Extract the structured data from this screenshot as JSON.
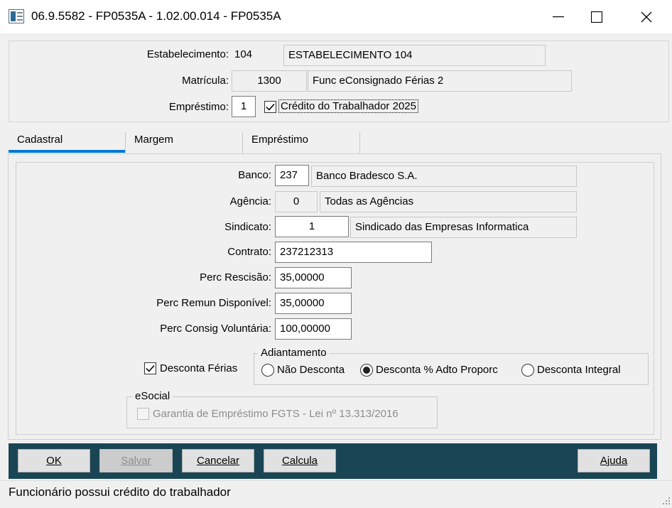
{
  "window": {
    "title": "06.9.5582 - FP0535A - 1.02.00.014 - FP0535A",
    "icon": "app-form-icon"
  },
  "header": {
    "estabelecimento_label": "Estabelecimento:",
    "estabelecimento_code": "104",
    "estabelecimento_name": "ESTABELECIMENTO 104",
    "matricula_label": "Matrícula:",
    "matricula_code": "1300",
    "matricula_name": "Func eConsignado Férias 2",
    "emprestimo_label": "Empréstimo:",
    "emprestimo_value": "1",
    "credito_label": "Crédito do Trabalhador 2025",
    "credito_checked": true
  },
  "tabs": [
    {
      "label": "Cadastral",
      "active": true
    },
    {
      "label": "Margem",
      "active": false
    },
    {
      "label": "Empréstimo",
      "active": false
    }
  ],
  "cadastral": {
    "banco_label": "Banco:",
    "banco_code": "237",
    "banco_name": "Banco Bradesco S.A.",
    "agencia_label": "Agência:",
    "agencia_code": "0",
    "agencia_name": "Todas as Agências",
    "sindicato_label": "Sindicato:",
    "sindicato_code": "1",
    "sindicato_name": "Sindicado das Empresas Informatica",
    "contrato_label": "Contrato:",
    "contrato_value": "237212313",
    "perc_rescisao_label": "Perc Rescisão:",
    "perc_rescisao_value": "35,00000",
    "perc_remun_label": "Perc Remun Disponível:",
    "perc_remun_value": "35,00000",
    "perc_consig_label": "Perc Consig Voluntária:",
    "perc_consig_value": "100,00000",
    "desconta_ferias_label": "Desconta Férias",
    "desconta_ferias_checked": true,
    "adiantamento": {
      "legend": "Adiantamento",
      "options": [
        {
          "label": "Não Desconta",
          "selected": false
        },
        {
          "label": "Desconta % Adto Proporc",
          "selected": true
        },
        {
          "label": "Desconta Integral",
          "selected": false
        }
      ]
    },
    "esocial": {
      "legend": "eSocial",
      "garantia_label": "Garantia de Empréstimo FGTS - Lei nº 13.313/2016",
      "garantia_checked": false
    }
  },
  "buttons": {
    "ok_label": "OK",
    "salvar_label": "Salvar",
    "cancelar_label": "Cancelar",
    "calcula_label": "Calcula",
    "ajuda_label": "Ajuda"
  },
  "status": {
    "text": "Funcionário possui crédito do trabalhador"
  },
  "colors": {
    "tab_accent": "#0078d7",
    "bottom_bar": "#1a4555"
  }
}
